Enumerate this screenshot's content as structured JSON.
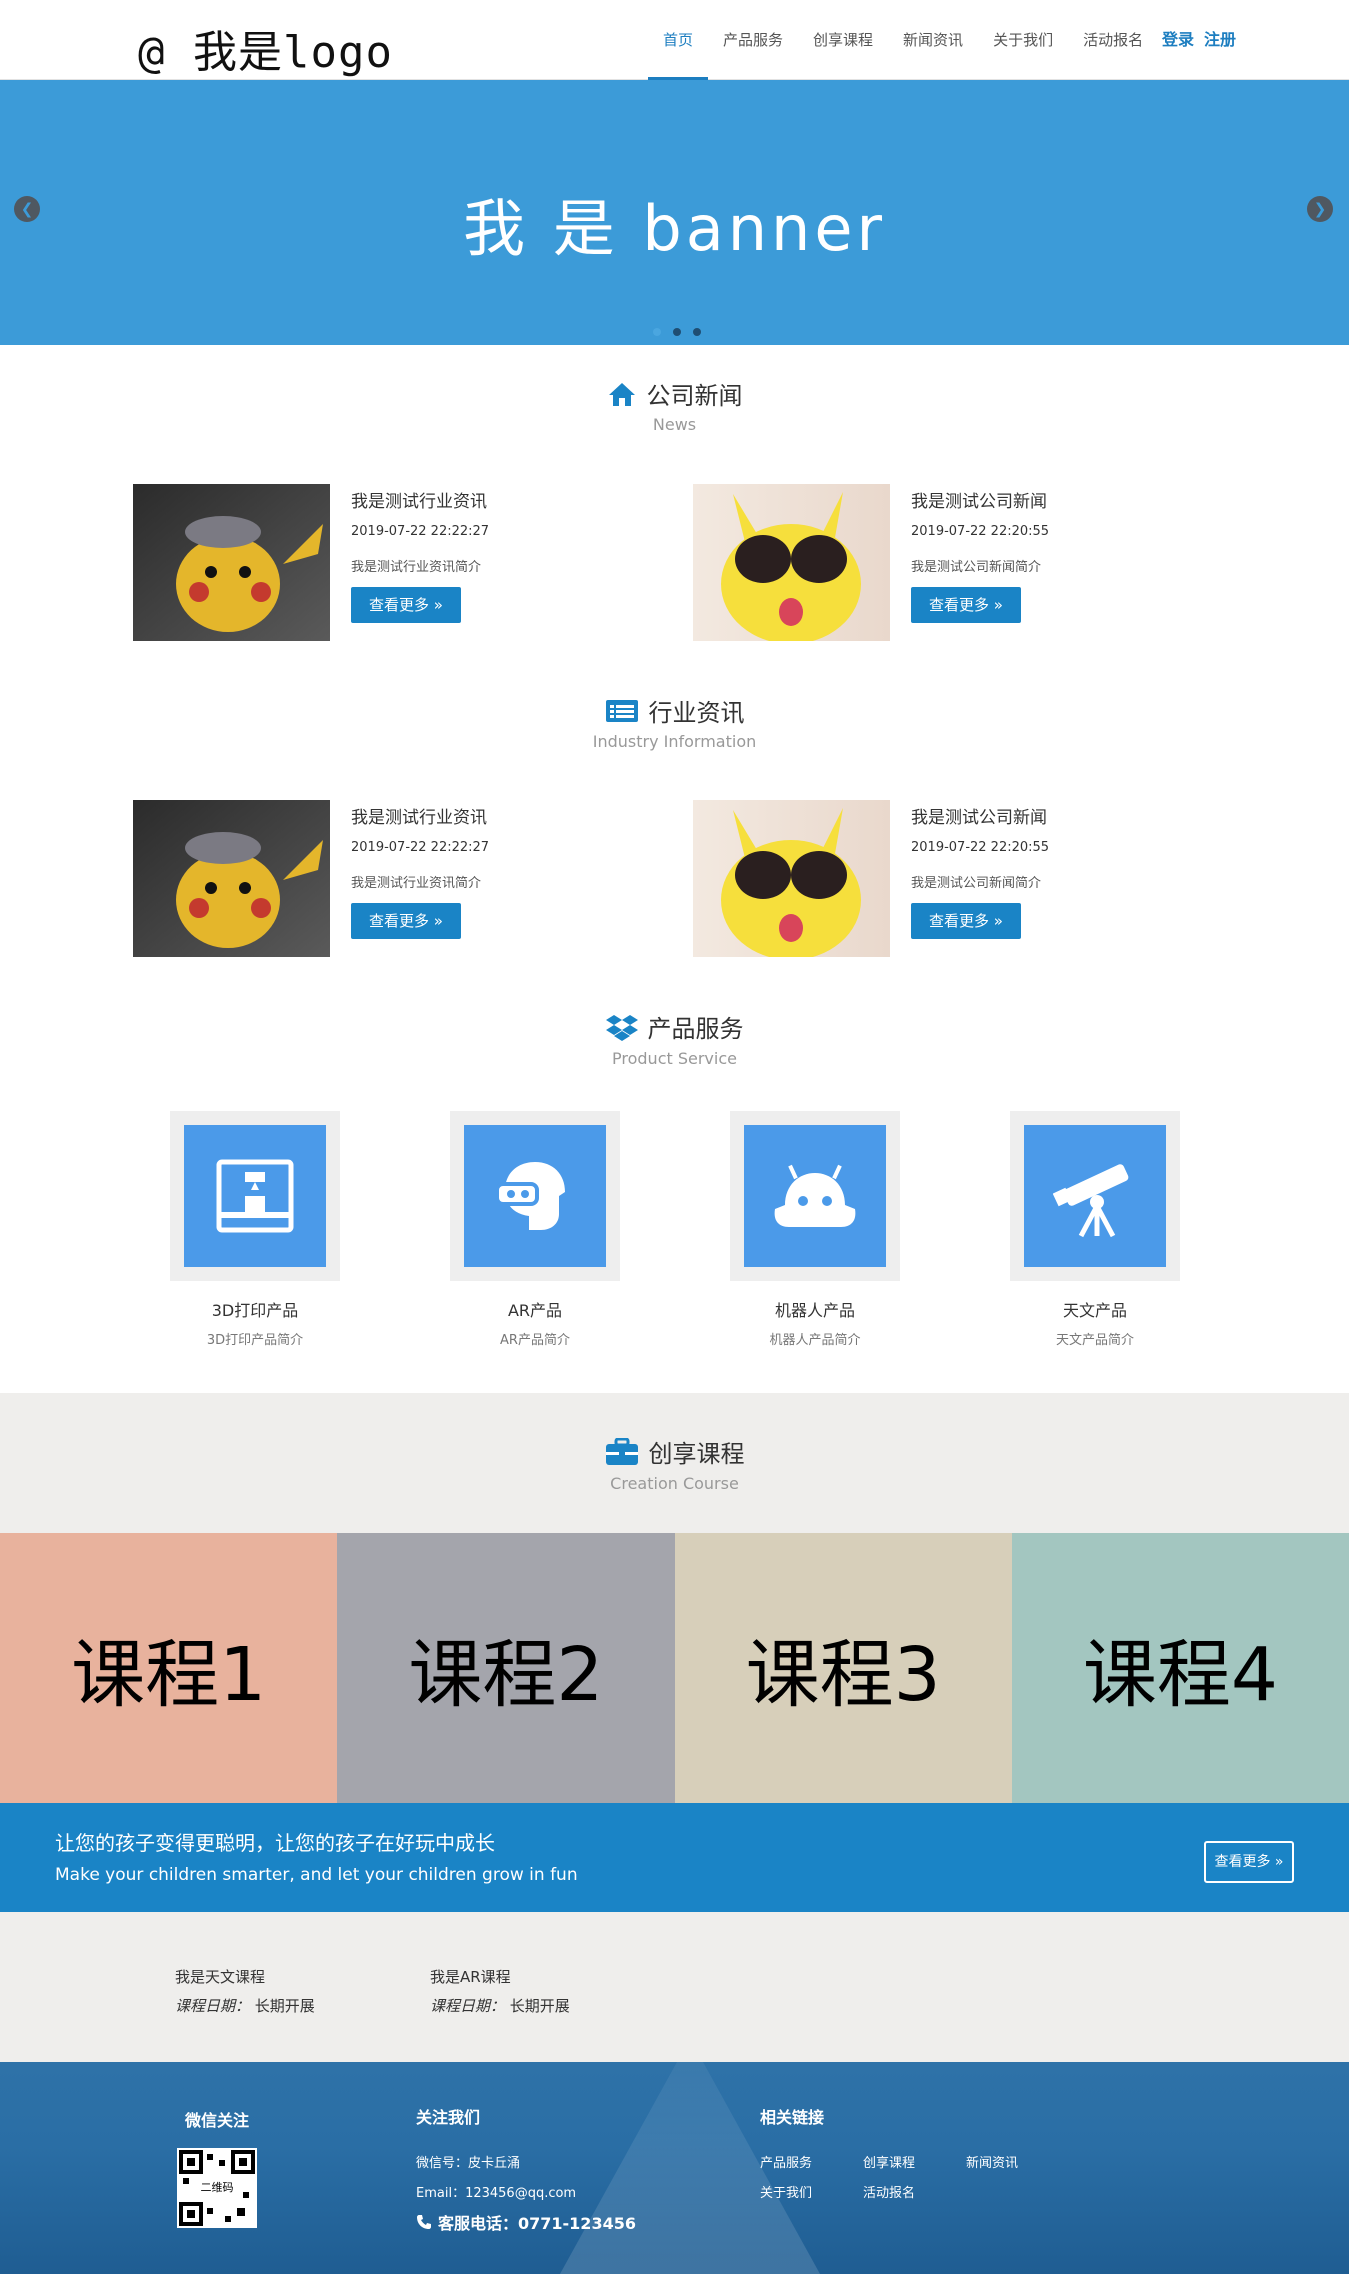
{
  "header": {
    "logo": "@ 我是logo",
    "nav": [
      "首页",
      "产品服务",
      "创享课程",
      "新闻资讯",
      "关于我们",
      "活动报名"
    ],
    "login": "登录",
    "register": "注册"
  },
  "banner": {
    "text": "我 是 banner"
  },
  "news": {
    "title": "公司新闻",
    "subtitle": "News",
    "items": [
      {
        "title": "我是测试行业资讯",
        "date": "2019-07-22 22:22:27",
        "desc": "我是测试行业资讯简介",
        "more": "查看更多 »"
      },
      {
        "title": "我是测试公司新闻",
        "date": "2019-07-22 22:20:55",
        "desc": "我是测试公司新闻简介",
        "more": "查看更多 »"
      }
    ]
  },
  "industry": {
    "title": "行业资讯",
    "subtitle": "Industry Information",
    "items": [
      {
        "title": "我是测试行业资讯",
        "date": "2019-07-22 22:22:27",
        "desc": "我是测试行业资讯简介",
        "more": "查看更多 »"
      },
      {
        "title": "我是测试公司新闻",
        "date": "2019-07-22 22:20:55",
        "desc": "我是测试公司新闻简介",
        "more": "查看更多 »"
      }
    ]
  },
  "products": {
    "title": "产品服务",
    "subtitle": "Product Service",
    "items": [
      {
        "name": "3D打印产品",
        "desc": "3D打印产品简介"
      },
      {
        "name": "AR产品",
        "desc": "AR产品简介"
      },
      {
        "name": "机器人产品",
        "desc": "机器人产品简介"
      },
      {
        "name": "天文产品",
        "desc": "天文产品简介"
      }
    ]
  },
  "courses": {
    "title": "创享课程",
    "subtitle": "Creation Course",
    "tiles": [
      "课程1",
      "课程2",
      "课程3",
      "课程4"
    ],
    "colors": [
      "#e8b29d",
      "#a4a5ac",
      "#d7cfba",
      "#a3c6c0"
    ]
  },
  "cta": {
    "zh": "让您的孩子变得更聪明，让您的孩子在好玩中成长",
    "en": "Make your children smarter, and let your children grow in fun",
    "button": "查看更多 »"
  },
  "course_list": [
    {
      "name": "我是天文课程",
      "date_label": "课程日期：",
      "date_value": "长期开展"
    },
    {
      "name": "我是AR课程",
      "date_label": "课程日期：",
      "date_value": "长期开展"
    }
  ],
  "footer": {
    "wechat_title": "微信关注",
    "qr_label": "二维码",
    "follow_title": "关注我们",
    "wechat_id": "微信号：皮卡丘涌",
    "email": "Email：123456@qq.com",
    "phone": "客服电话：0771-123456",
    "links_title": "相关链接",
    "links": [
      "产品服务",
      "创享课程",
      "新闻资讯",
      "关于我们",
      "活动报名"
    ]
  },
  "theme": {
    "primary": "#1a84c6",
    "banner": "#3c9bd8",
    "product_icon_bg": "#4b9ae9"
  }
}
